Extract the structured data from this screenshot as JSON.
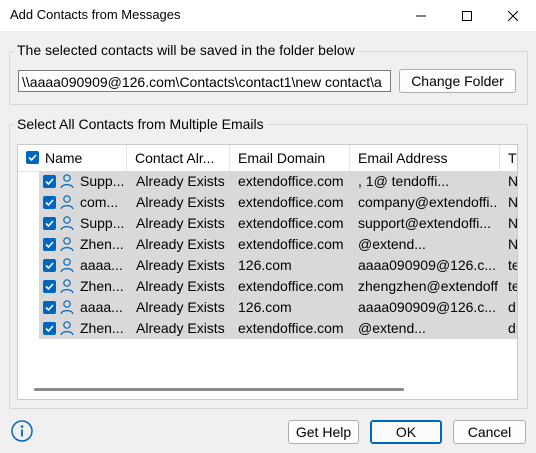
{
  "window": {
    "title": "Add Contacts from Messages"
  },
  "folder_group": {
    "label": "The selected contacts will be saved in the folder below",
    "path": "\\\\aaaa090909@126.com\\Contacts\\contact1\\new contact\\a",
    "change_button": "Change Folder"
  },
  "contacts_group": {
    "label": "Select All Contacts from Multiple Emails",
    "columns": [
      "Name",
      "Contact Alr...",
      "Email Domain",
      "Email Address",
      "Ti"
    ],
    "rows": [
      {
        "name": "Supp...",
        "status": "Already Exists",
        "domain": "extendoffice.com",
        "email": "    ,      1@    tendoffi...",
        "extra": "N"
      },
      {
        "name": "com...",
        "status": "Already Exists",
        "domain": "extendoffice.com",
        "email": "company@extendoffi...",
        "extra": "N"
      },
      {
        "name": "Supp...",
        "status": "Already Exists",
        "domain": "extendoffice.com",
        "email": "support@extendoffi...",
        "extra": "N"
      },
      {
        "name": "Zhen...",
        "status": "Already Exists",
        "domain": "extendoffice.com",
        "email": "         @extend...",
        "extra": "N"
      },
      {
        "name": "aaaa...",
        "status": "Already Exists",
        "domain": "126.com",
        "email": "aaaa090909@126.c...",
        "extra": "te"
      },
      {
        "name": "Zhen...",
        "status": "Already Exists",
        "domain": "extendoffice.com",
        "email": "zhengzhen@extendoffi...",
        "extra": "te"
      },
      {
        "name": "aaaa...",
        "status": "Already Exists",
        "domain": "126.com",
        "email": "aaaa090909@126.c...",
        "extra": "d"
      },
      {
        "name": "Zhen...",
        "status": "Already Exists",
        "domain": "extendoffice.com",
        "email": "         @extend...",
        "extra": "d"
      }
    ]
  },
  "footer": {
    "help_button": "Get Help",
    "ok_button": "OK",
    "cancel_button": "Cancel"
  },
  "colors": {
    "accent": "#0067c0",
    "row_bg": "#d9d9d9",
    "window_bg": "#f0f0f0"
  },
  "icons": [
    "minimize-icon",
    "maximize-icon",
    "close-icon",
    "checkbox-icon",
    "person-icon",
    "info-icon"
  ]
}
